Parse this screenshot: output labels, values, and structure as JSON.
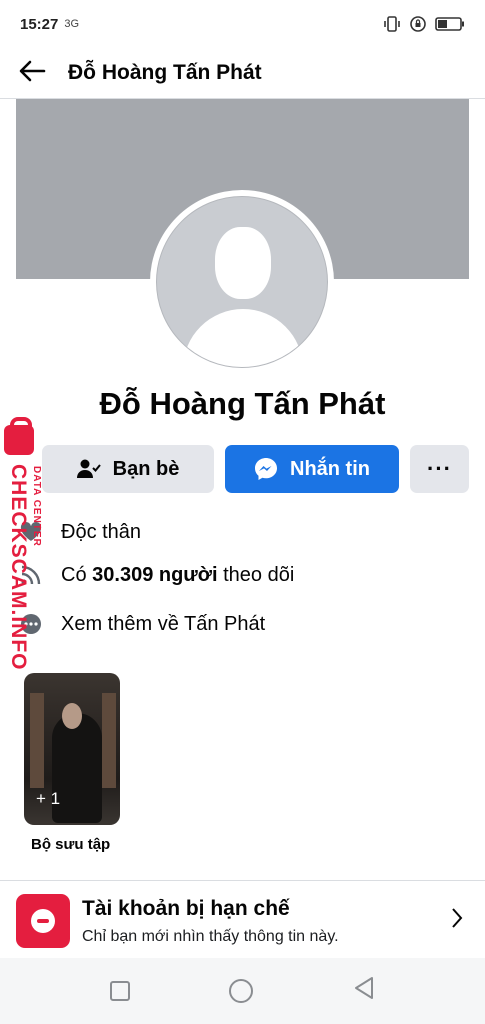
{
  "status_bar": {
    "time": "15:27",
    "signal_note": "3G",
    "icons": [
      "vibrate-icon",
      "lock-rotation-icon",
      "battery-icon"
    ]
  },
  "header": {
    "title": "Đỗ Hoàng Tấn Phát"
  },
  "profile": {
    "name": "Đỗ Hoàng Tấn Phát"
  },
  "actions": {
    "friends_label": "Bạn bè",
    "message_label": "Nhắn tin",
    "more_label": "···"
  },
  "info": {
    "relationship": "Độc thân",
    "followers_prefix": "Có",
    "followers_count": "30.309 người",
    "followers_suffix": "theo dõi",
    "see_more": "Xem thêm về Tấn Phát"
  },
  "collection": {
    "count": "+ 1",
    "label": "Bộ sưu tập"
  },
  "restricted": {
    "title": "Tài khoản bị hạn chế",
    "subtitle": "Chỉ bạn mới nhìn thấy thông tin này."
  },
  "watermark": {
    "main": "CHECKSCAM.INFO",
    "sub": "DATA CENTER"
  },
  "colors": {
    "accent": "#1b74e4",
    "danger": "#e41e3f",
    "cover": "#a5a8ad"
  }
}
